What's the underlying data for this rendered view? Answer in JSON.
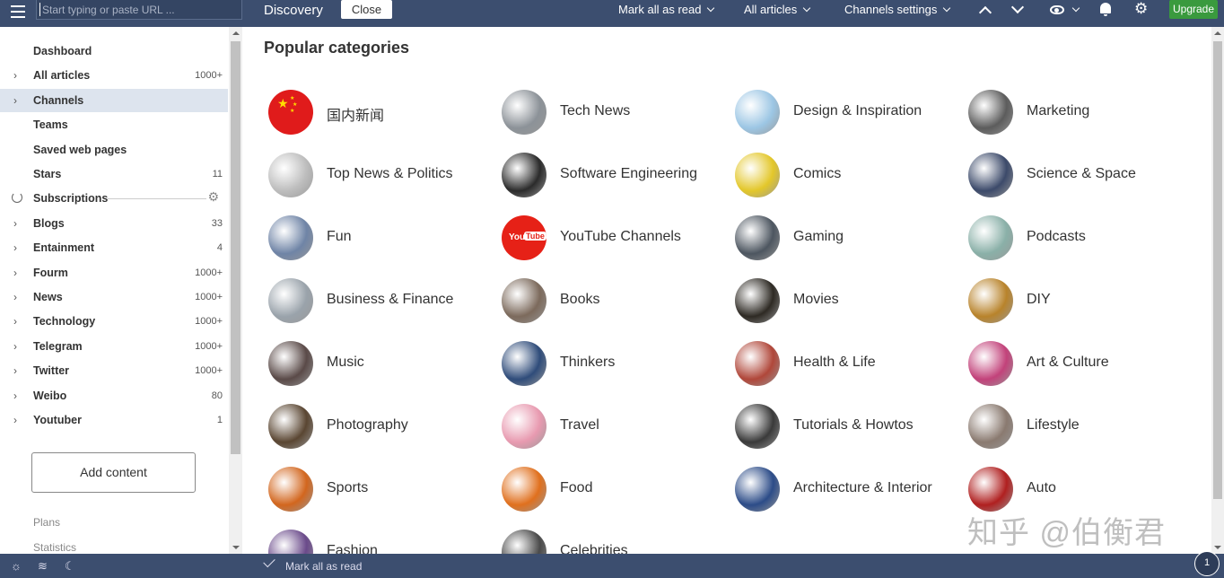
{
  "topbar": {
    "search_placeholder": "Start typing or paste URL ...",
    "view_title": "Discovery",
    "close_label": "Close",
    "mark_all_read": "Mark all as read",
    "all_articles": "All articles",
    "channels_settings": "Channels settings",
    "upgrade_label": "Upgrade"
  },
  "sidebar": {
    "items": [
      {
        "label": "Dashboard",
        "count": "",
        "expandable": false
      },
      {
        "label": "All articles",
        "count": "1000+",
        "expandable": true
      },
      {
        "label": "Channels",
        "count": "",
        "expandable": true,
        "active": true
      },
      {
        "label": "Teams",
        "count": "",
        "expandable": false
      },
      {
        "label": "Saved web pages",
        "count": "",
        "expandable": false
      },
      {
        "label": "Stars",
        "count": "11",
        "expandable": false
      },
      {
        "label": "Subscriptions",
        "count": "",
        "expandable": false
      },
      {
        "label": "Blogs",
        "count": "33",
        "expandable": true
      },
      {
        "label": "Entainment",
        "count": "4",
        "expandable": true
      },
      {
        "label": "Fourm",
        "count": "1000+",
        "expandable": true
      },
      {
        "label": "News",
        "count": "1000+",
        "expandable": true
      },
      {
        "label": "Technology",
        "count": "1000+",
        "expandable": true
      },
      {
        "label": "Telegram",
        "count": "1000+",
        "expandable": true
      },
      {
        "label": "Twitter",
        "count": "1000+",
        "expandable": true
      },
      {
        "label": "Weibo",
        "count": "80",
        "expandable": true
      },
      {
        "label": "Youtuber",
        "count": "1",
        "expandable": true
      }
    ],
    "add_content": "Add content",
    "plans": "Plans",
    "statistics": "Statistics"
  },
  "main": {
    "title": "Popular categories",
    "categories": [
      {
        "name": "国内新闻",
        "icon": "china-flag-icon",
        "color": "#e01b1b"
      },
      {
        "name": "Tech News",
        "icon": "robot-icon",
        "color": "#8c9298"
      },
      {
        "name": "Design & Inspiration",
        "icon": "paper-plane-icon",
        "color": "#9cc6e4"
      },
      {
        "name": "Marketing",
        "icon": "gadgets-icon",
        "color": "#5c5c5c"
      },
      {
        "name": "Top News & Politics",
        "icon": "newspaper-icon",
        "color": "#bdbdbd"
      },
      {
        "name": "Software Engineering",
        "icon": "code-icon",
        "color": "#2b2b2b"
      },
      {
        "name": "Comics",
        "icon": "comic-icon",
        "color": "#e3c72a"
      },
      {
        "name": "Science & Space",
        "icon": "telescope-icon",
        "color": "#3c4a6a"
      },
      {
        "name": "Fun",
        "icon": "cat-icon",
        "color": "#6f84a6"
      },
      {
        "name": "YouTube Channels",
        "icon": "youtube-icon",
        "color": "#e62117"
      },
      {
        "name": "Gaming",
        "icon": "gamepad-icon",
        "color": "#4d5660"
      },
      {
        "name": "Podcasts",
        "icon": "microphone-icon",
        "color": "#8ab0a8"
      },
      {
        "name": "Business & Finance",
        "icon": "businessman-icon",
        "color": "#9aa3ab"
      },
      {
        "name": "Books",
        "icon": "book-icon",
        "color": "#7c6a5c"
      },
      {
        "name": "Movies",
        "icon": "film-icon",
        "color": "#2e2a24"
      },
      {
        "name": "DIY",
        "icon": "tools-icon",
        "color": "#b8832b"
      },
      {
        "name": "Music",
        "icon": "singer-icon",
        "color": "#5a4a48"
      },
      {
        "name": "Thinkers",
        "icon": "statue-icon",
        "color": "#2f4c7a"
      },
      {
        "name": "Health & Life",
        "icon": "health-icon",
        "color": "#b0473a"
      },
      {
        "name": "Art & Culture",
        "icon": "art-icon",
        "color": "#c2427a"
      },
      {
        "name": "Photography",
        "icon": "camera-icon",
        "color": "#5a4632"
      },
      {
        "name": "Travel",
        "icon": "travel-icon",
        "color": "#e89ab0"
      },
      {
        "name": "Tutorials & Howtos",
        "icon": "tutorial-icon",
        "color": "#3a3a3a"
      },
      {
        "name": "Lifestyle",
        "icon": "lifestyle-icon",
        "color": "#8a7a70"
      },
      {
        "name": "Sports",
        "icon": "ball-icon",
        "color": "#d2661e"
      },
      {
        "name": "Food",
        "icon": "carrot-icon",
        "color": "#e0701e"
      },
      {
        "name": "Architecture & Interior",
        "icon": "building-icon",
        "color": "#2c4c88"
      },
      {
        "name": "Auto",
        "icon": "car-icon",
        "color": "#b02020"
      },
      {
        "name": "Fashion",
        "icon": "fashion-icon",
        "color": "#6a4a8a"
      },
      {
        "name": "Celebrities",
        "icon": "celebrity-icon",
        "color": "#4a4a4a"
      }
    ]
  },
  "bottombar": {
    "mark_all_read": "Mark all as read",
    "badge": "1"
  },
  "watermark": "知乎 @伯衡君",
  "colors": {
    "navbar": "#3c4e6f",
    "upgrade": "#3a9a3e",
    "active_item": "#dde4ee"
  }
}
